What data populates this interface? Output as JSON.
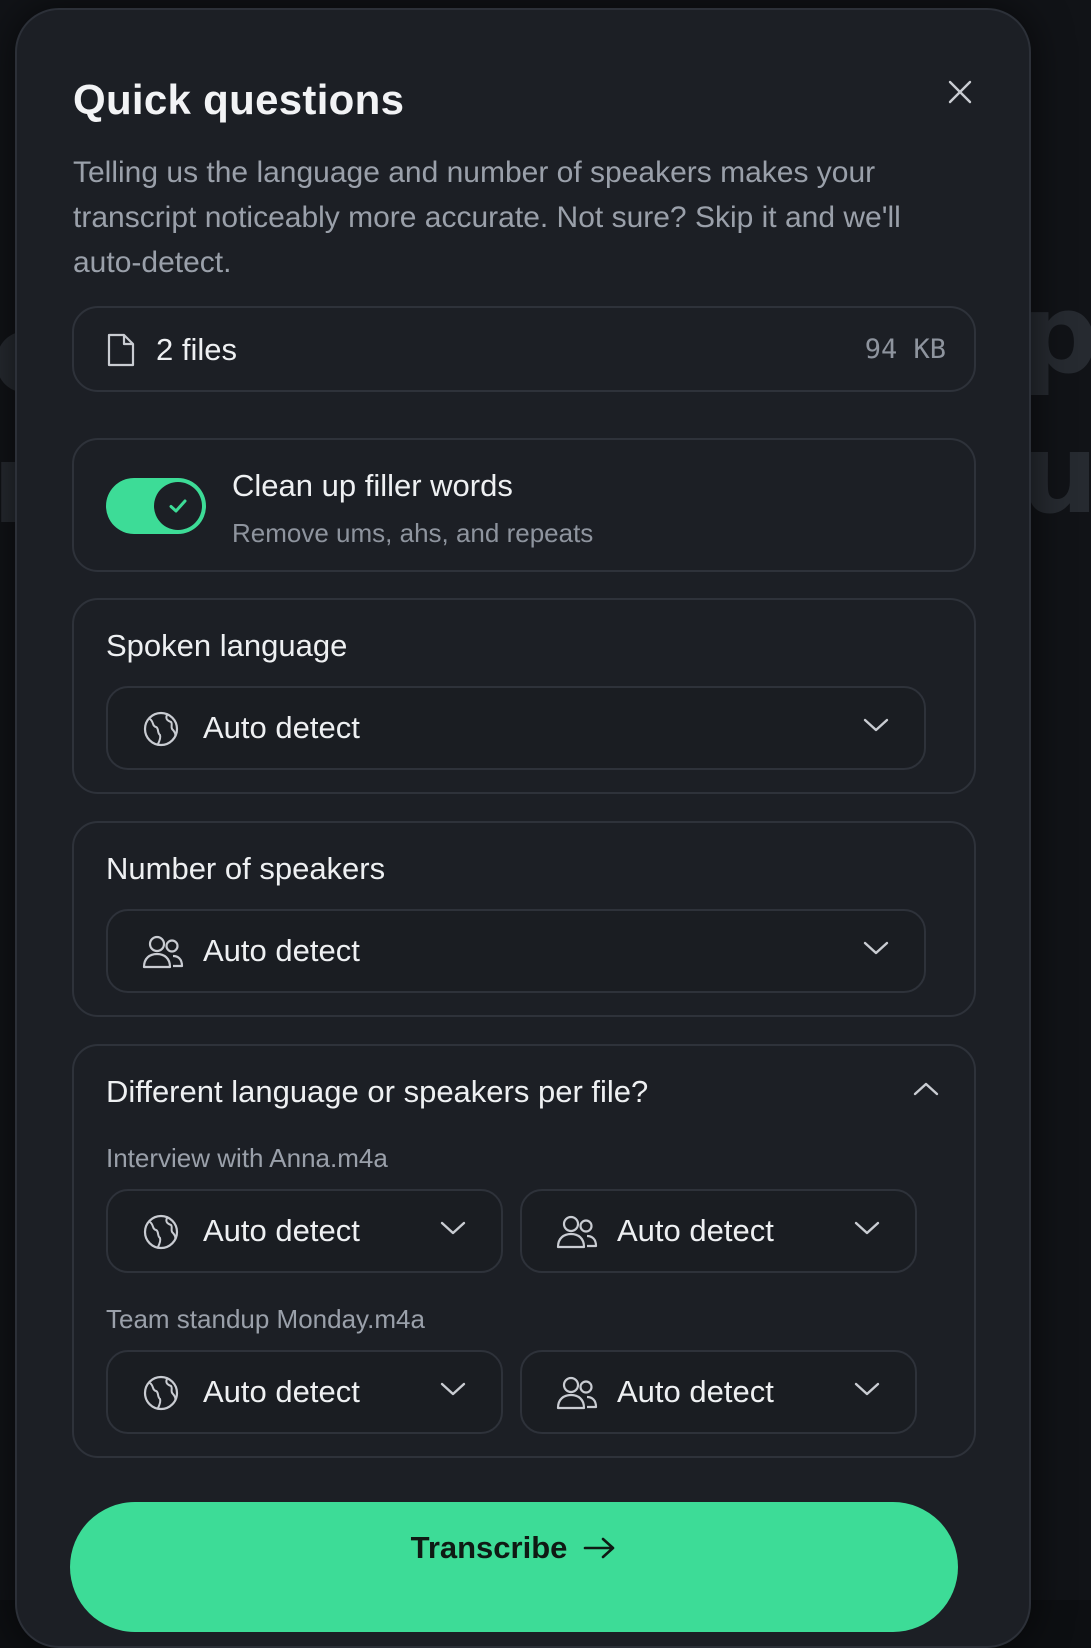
{
  "modal": {
    "title": "Quick questions",
    "subtitle": "Telling us the language and number of speakers makes your transcript noticeably more accurate. Not sure? Skip it and we'll auto-detect.",
    "close_icon": "close-icon"
  },
  "files": {
    "label": "2 files",
    "size": "94 KB",
    "icon": "file-icon"
  },
  "filler": {
    "title": "Clean up filler words",
    "description": "Remove ums, ahs, and repeats",
    "enabled": true,
    "accent": "#3ddc97"
  },
  "language": {
    "label": "Spoken language",
    "value": "Auto detect",
    "icon": "globe-icon"
  },
  "speakers": {
    "label": "Number of speakers",
    "value": "Auto detect",
    "icon": "users-icon"
  },
  "per_file": {
    "title": "Different language or speakers per file?",
    "expanded": true,
    "files": [
      {
        "name": "Interview with Anna.m4a",
        "language": "Auto detect",
        "speakers": "Auto detect"
      },
      {
        "name": "Team standup Monday.m4a",
        "language": "Auto detect",
        "speakers": "Auto detect"
      }
    ]
  },
  "transcribe": {
    "label": "Transcribe",
    "icon": "arrow-right-icon"
  },
  "colors": {
    "modal_bg": "#1c1f25",
    "border": "#2e323a",
    "accent": "#3ddc97",
    "text": "#eef0f2",
    "muted": "#8e949e"
  }
}
